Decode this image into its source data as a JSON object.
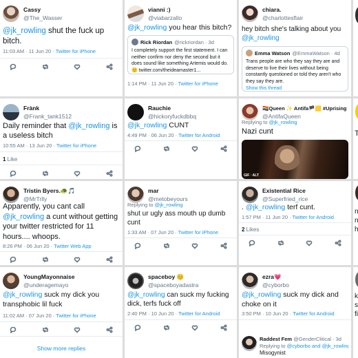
{
  "tweets": {
    "t1": {
      "name": "Cassy",
      "handle": "@The_Wasser",
      "mention": "@jk_rowling",
      "text": " shut the fuck up bitch.",
      "meta": "11:03 AM · 11 Jun 20 · ",
      "source": "Twitter for iPhone"
    },
    "t2": {
      "name": "vianni :)",
      "handle": "@viabarzallo",
      "mention": "@jk_rowling",
      "text": " you hear this bitch?",
      "quote": {
        "name": "Rick Riordan",
        "handle": "@rickriordan · 3d",
        "text": "I completely support the first statement. I can neither confirm nor deny the second but it does sound like something Artemis would do. 🙂 twitter.com/theideamaster1..."
      },
      "meta": "1:14 PM · 11 Jun 20 · ",
      "source": "Twitter for iPhone"
    },
    "t3": {
      "name": "chiara.",
      "handle": "@charlottesflair",
      "text": "hey bitch she's talking about you ",
      "mention": "@jk_rowling",
      "quote": {
        "name": "Emma Watson",
        "handle": "@EmmaWatson · 4d",
        "text": "Trans people are who they say they are and deserve to live their lives without being constantly questioned or told they aren't who they say they are.",
        "thread": "Show this thread"
      }
    },
    "t4": {
      "name": "Frànk",
      "handle": "@Frank_tank1512",
      "text1": "Daily reminder that ",
      "mention": "@jk_rowling",
      "text2": "  is a useless bitch",
      "meta": "10:55 AM · 13 Jun 20 · ",
      "source": "Twitter for iPhone",
      "likes_count": "1",
      "likes_label": " Like"
    },
    "t5": {
      "name": "Rauchie",
      "handle": "@hickoryfuckdbbq",
      "mention": "@jk_rowling",
      "text": " CUNT",
      "meta": "4:49 PM · 06 Jun 20 · ",
      "source": "Twitter for Android"
    },
    "t6": {
      "name": "🏳️‍🌈Queen ✨ Antifa🏴🟨 #Uprising",
      "handle": "@AntifaQueen",
      "reply_prefix": "Replying to ",
      "reply_to": "@jk_rowling",
      "text": "Nazi cunt",
      "media_badge": "GIF · ALT"
    },
    "t7": {
      "name": "Tristin Byers.🐢🎵",
      "handle": "@MrTrlly",
      "text1": "Apparently, you cant call ",
      "mention": "@jk_rowling",
      "text2": " a cunt without getting your twitter restricted for 11 hours.... whoops.",
      "meta": "8:26 PM · 06 Jun 20 · ",
      "source": "Twitter Web App"
    },
    "t8": {
      "name": "mar",
      "handle": "@metobeyours",
      "reply_prefix": "Replying to ",
      "reply_to": "@jk_rowling",
      "text": "shut ur ugly ass mouth up dumb cunt",
      "meta": "1:33 AM · 07 Jun 20 · ",
      "source": "Twitter for iPhone"
    },
    "t9": {
      "name": "Existential Rice",
      "handle": "@Superfried_rice",
      "prefix": ". ",
      "mention": "@jk_rowling",
      "text": " terf cunt.",
      "meta": "1:57 PM · 11 Jun 20 · ",
      "source": "Twitter for Android",
      "likes_count": "2",
      "likes_label": " Likes"
    },
    "t10": {
      "name": "YoungMayonnaise",
      "handle": "@underagemayo",
      "mention": "@jk_rowling",
      "text": " suck my dick you transphobic lil fuck",
      "meta": "11:02 AM · 07 Jun 20 · ",
      "source": "Twitter for iPhone",
      "more": "Show more replies"
    },
    "t11": {
      "name": "spaceboy 😊",
      "handle": "@spaceboyadastra",
      "mention": "@jk_rowling",
      "text": " can suck my fucking dick, terfs fuck off",
      "meta": "2:40 PM · 10 Jun 20 · ",
      "source": "Twitter for Android"
    },
    "t12": {
      "name": "ezra💗",
      "handle": "@cyborbo",
      "mention": "@jk_rowling",
      "text": " suck my dick and choke on it",
      "meta": "3:50 PM · 10 Jun 20 · ",
      "source": "Twitter for Android",
      "reply_name": "Raddest Fem",
      "reply_handle": "@GenderClitical · 3d",
      "reply_line_prefix": "Replying to ",
      "reply_line_users": "@cyborbo and @jk_rowling",
      "reply_text": "Misogynist"
    },
    "edge": {
      "r1": "",
      "r2a": "T",
      "r3a": "n",
      "r3b": "n",
      "r3c": "h",
      "r4a": "k",
      "r4b": "s",
      "r4c": "fi"
    }
  },
  "colors": {
    "link": "#1b95e0",
    "muted": "#657786",
    "text": "#14171a"
  }
}
